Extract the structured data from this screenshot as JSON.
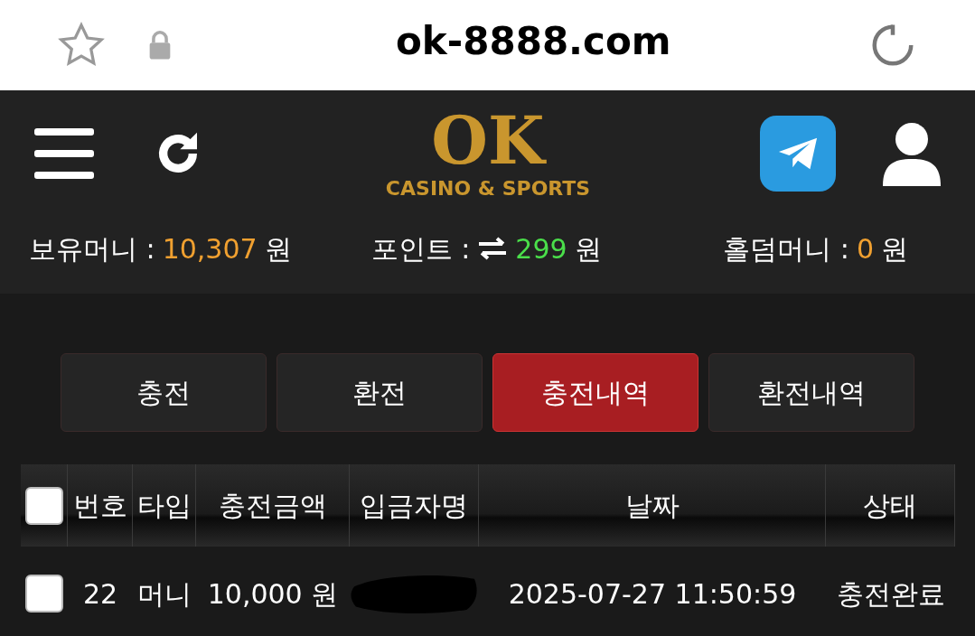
{
  "browser": {
    "url": "ok-8888.com"
  },
  "header": {
    "logo": "OK",
    "tagline": "CASINO & SPORTS"
  },
  "balances": [
    {
      "kind": "money",
      "label": "보유머니 :",
      "value": "10,307",
      "unit": "원"
    },
    {
      "kind": "points",
      "label": "포인트 :",
      "value": "299",
      "unit": "원"
    },
    {
      "kind": "money",
      "label": "홀덤머니 :",
      "value": "0",
      "unit": "원"
    }
  ],
  "tabs": [
    {
      "label": "충전",
      "selected": false
    },
    {
      "label": "환전",
      "selected": false
    },
    {
      "label": "충전내역",
      "selected": true
    },
    {
      "label": "환전내역",
      "selected": false
    }
  ],
  "table": {
    "header_checked": false,
    "columns": [
      "번호",
      "타입",
      "충전금액",
      "입금자명",
      "날짜",
      "상태"
    ],
    "rows": [
      {
        "checked": false,
        "cells": [
          "22",
          "머니",
          "10,000 원",
          null,
          "2025-07-27 11:50:59",
          "충전완료"
        ]
      }
    ]
  }
}
